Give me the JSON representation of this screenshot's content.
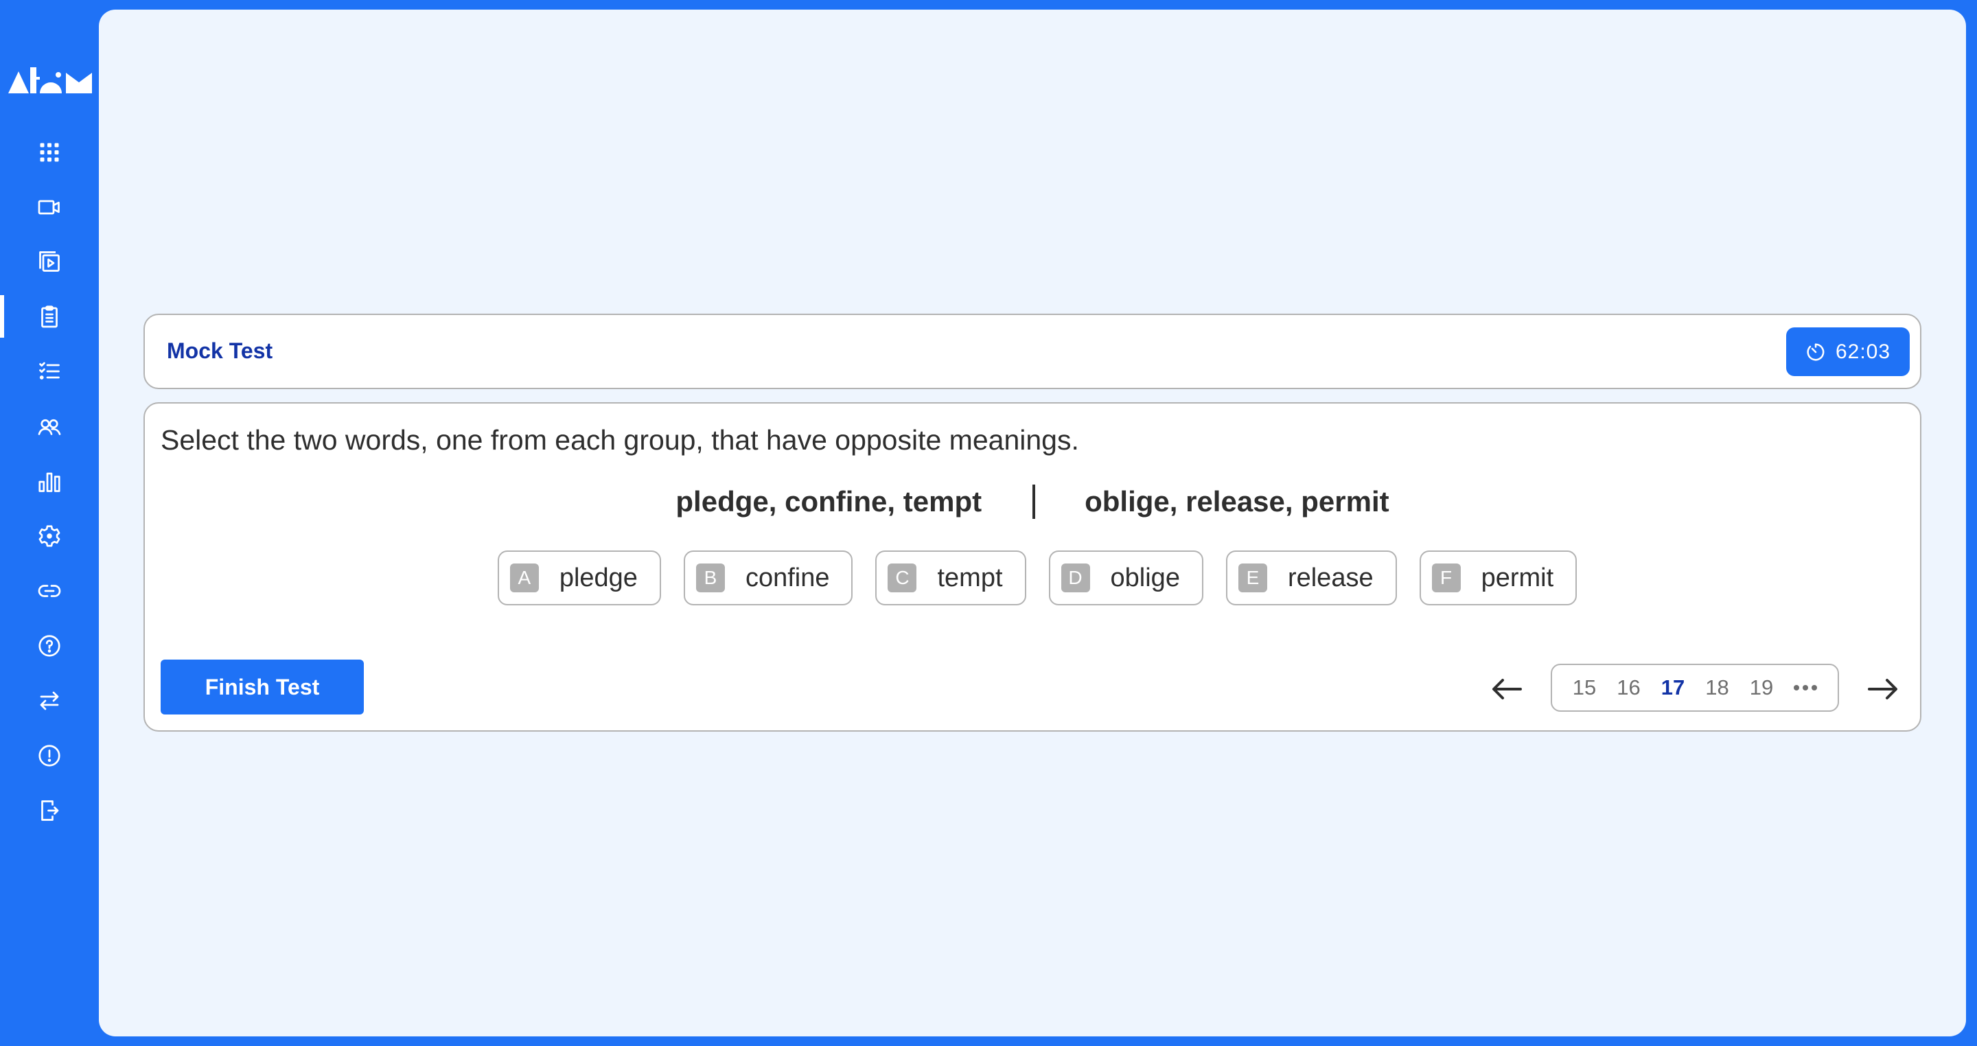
{
  "app": {
    "name": "Atom",
    "colors": {
      "brand": "#1F72F6",
      "title": "#1233A6",
      "panel_bg": "#EEF5FE",
      "badge": "#B0B0B0"
    }
  },
  "sidebar": {
    "items": [
      {
        "icon": "apps-grid-icon",
        "label": "Dashboard",
        "active": false
      },
      {
        "icon": "video-camera-icon",
        "label": "Live Classes",
        "active": false
      },
      {
        "icon": "video-library-icon",
        "label": "Recorded Videos",
        "active": false
      },
      {
        "icon": "clipboard-icon",
        "label": "Tests",
        "active": true
      },
      {
        "icon": "checklist-icon",
        "label": "Practice",
        "active": false
      },
      {
        "icon": "users-icon",
        "label": "Community",
        "active": false
      },
      {
        "icon": "bar-chart-icon",
        "label": "Analytics",
        "active": false
      },
      {
        "icon": "gear-icon",
        "label": "Settings",
        "active": false
      },
      {
        "icon": "link-icon",
        "label": "Links",
        "active": false
      },
      {
        "icon": "help-icon",
        "label": "Help",
        "active": false
      },
      {
        "icon": "swap-arrows-icon",
        "label": "Switch",
        "active": false
      },
      {
        "icon": "alert-icon",
        "label": "Report",
        "active": false
      },
      {
        "icon": "logout-icon",
        "label": "Logout",
        "active": false
      }
    ]
  },
  "header": {
    "title": "Mock Test",
    "timer": {
      "icon": "stopwatch-icon",
      "value": "62:03"
    }
  },
  "question": {
    "prompt": "Select the two words, one from each group, that have opposite meanings.",
    "group_left": "pledge, confine, tempt",
    "group_right": "oblige, release, permit",
    "options": [
      {
        "letter": "A",
        "word": "pledge"
      },
      {
        "letter": "B",
        "word": "confine"
      },
      {
        "letter": "C",
        "word": "tempt"
      },
      {
        "letter": "D",
        "word": "oblige"
      },
      {
        "letter": "E",
        "word": "release"
      },
      {
        "letter": "F",
        "word": "permit"
      }
    ]
  },
  "footer": {
    "finish_label": "Finish Test",
    "pagination": {
      "pages": [
        "15",
        "16",
        "17",
        "18",
        "19"
      ],
      "current": "17",
      "has_more": true
    }
  }
}
